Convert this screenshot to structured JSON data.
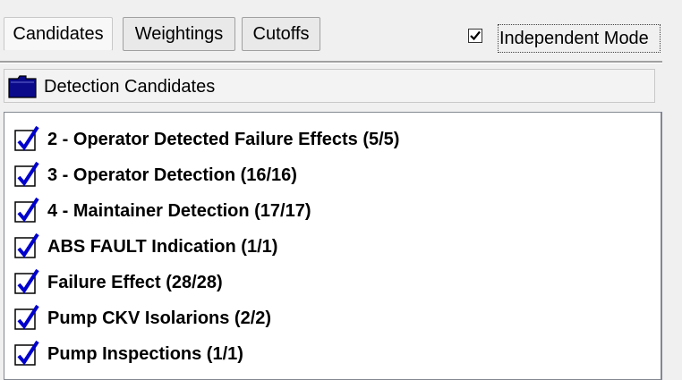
{
  "tabs": [
    {
      "label": "Candidates",
      "active": true
    },
    {
      "label": "Weightings",
      "active": false
    },
    {
      "label": "Cutoffs",
      "active": false
    }
  ],
  "independent_mode": {
    "label": "Independent Mode",
    "checked": true
  },
  "panel": {
    "title": "Detection Candidates",
    "icon": "folder-icon"
  },
  "candidates": [
    {
      "label": "2 - Operator Detected Failure Effects (5/5)",
      "checked": true
    },
    {
      "label": "3 - Operator Detection (16/16)",
      "checked": true
    },
    {
      "label": "4 - Maintainer Detection (17/17)",
      "checked": true
    },
    {
      "label": "ABS FAULT Indication (1/1)",
      "checked": true
    },
    {
      "label": "Failure Effect (28/28)",
      "checked": true
    },
    {
      "label": "Pump CKV Isolarions (2/2)",
      "checked": true
    },
    {
      "label": "Pump Inspections (1/1)",
      "checked": true
    }
  ],
  "colors": {
    "check": "#0000cc",
    "folder": "#0a0a8a"
  }
}
